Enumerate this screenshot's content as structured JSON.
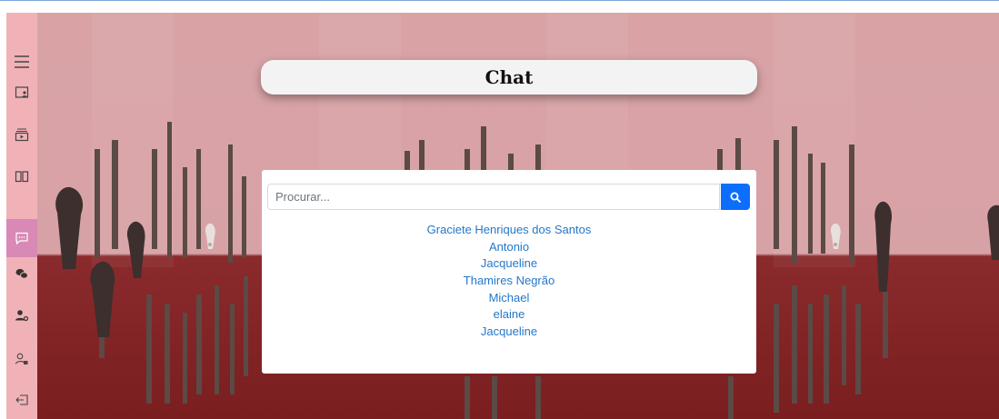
{
  "app": {
    "title": "Chat"
  },
  "sidebar": {
    "items": [
      {
        "name": "menu",
        "icon": "menu-icon"
      },
      {
        "name": "profile",
        "icon": "profile-card-icon"
      },
      {
        "name": "videos",
        "icon": "video-tray-icon"
      },
      {
        "name": "courses",
        "icon": "book-icon"
      },
      {
        "name": "chat",
        "icon": "chat-bubble-icon",
        "active": true
      },
      {
        "name": "community",
        "icon": "group-chat-icon"
      },
      {
        "name": "users",
        "icon": "users-settings-icon"
      },
      {
        "name": "account",
        "icon": "user-lock-icon"
      },
      {
        "name": "logout",
        "icon": "logout-icon"
      }
    ],
    "active_color": "#d989b5",
    "bg_color": "#f1b2b7"
  },
  "search": {
    "placeholder": "Procurar...",
    "value": "",
    "button_icon": "search-icon",
    "button_color": "#0d6efd"
  },
  "contacts": [
    "Graciete Henriques dos Santos",
    "Antonio",
    "Jacqueline",
    "Thamires Negrão",
    "Michael",
    "elaine",
    "Jacqueline"
  ],
  "colors": {
    "link": "#2378c8",
    "background_top": "#d9a3a6",
    "background_bottom": "#7a1e20"
  }
}
